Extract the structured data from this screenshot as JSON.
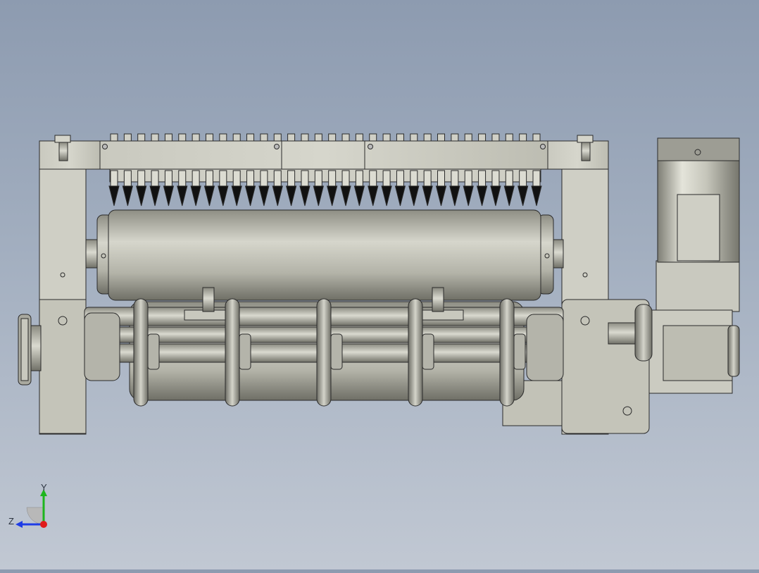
{
  "viewport": {
    "background_top": "#8d9bb0",
    "background_bottom": "#c1c8d3",
    "model_colors": {
      "metal_light": "#d9d9cf",
      "metal_mid": "#b8b8ad",
      "metal_dark": "#7d7d74",
      "edge": "#2a2a2a",
      "spike": "#111111"
    }
  },
  "view_triad": {
    "y_label": "Y",
    "z_label": "Z",
    "y_color": "#1db51d",
    "z_color": "#1e3ce6",
    "x_color": "#e01b1b"
  },
  "model": {
    "spike_count": 32,
    "ring_count": 5
  }
}
